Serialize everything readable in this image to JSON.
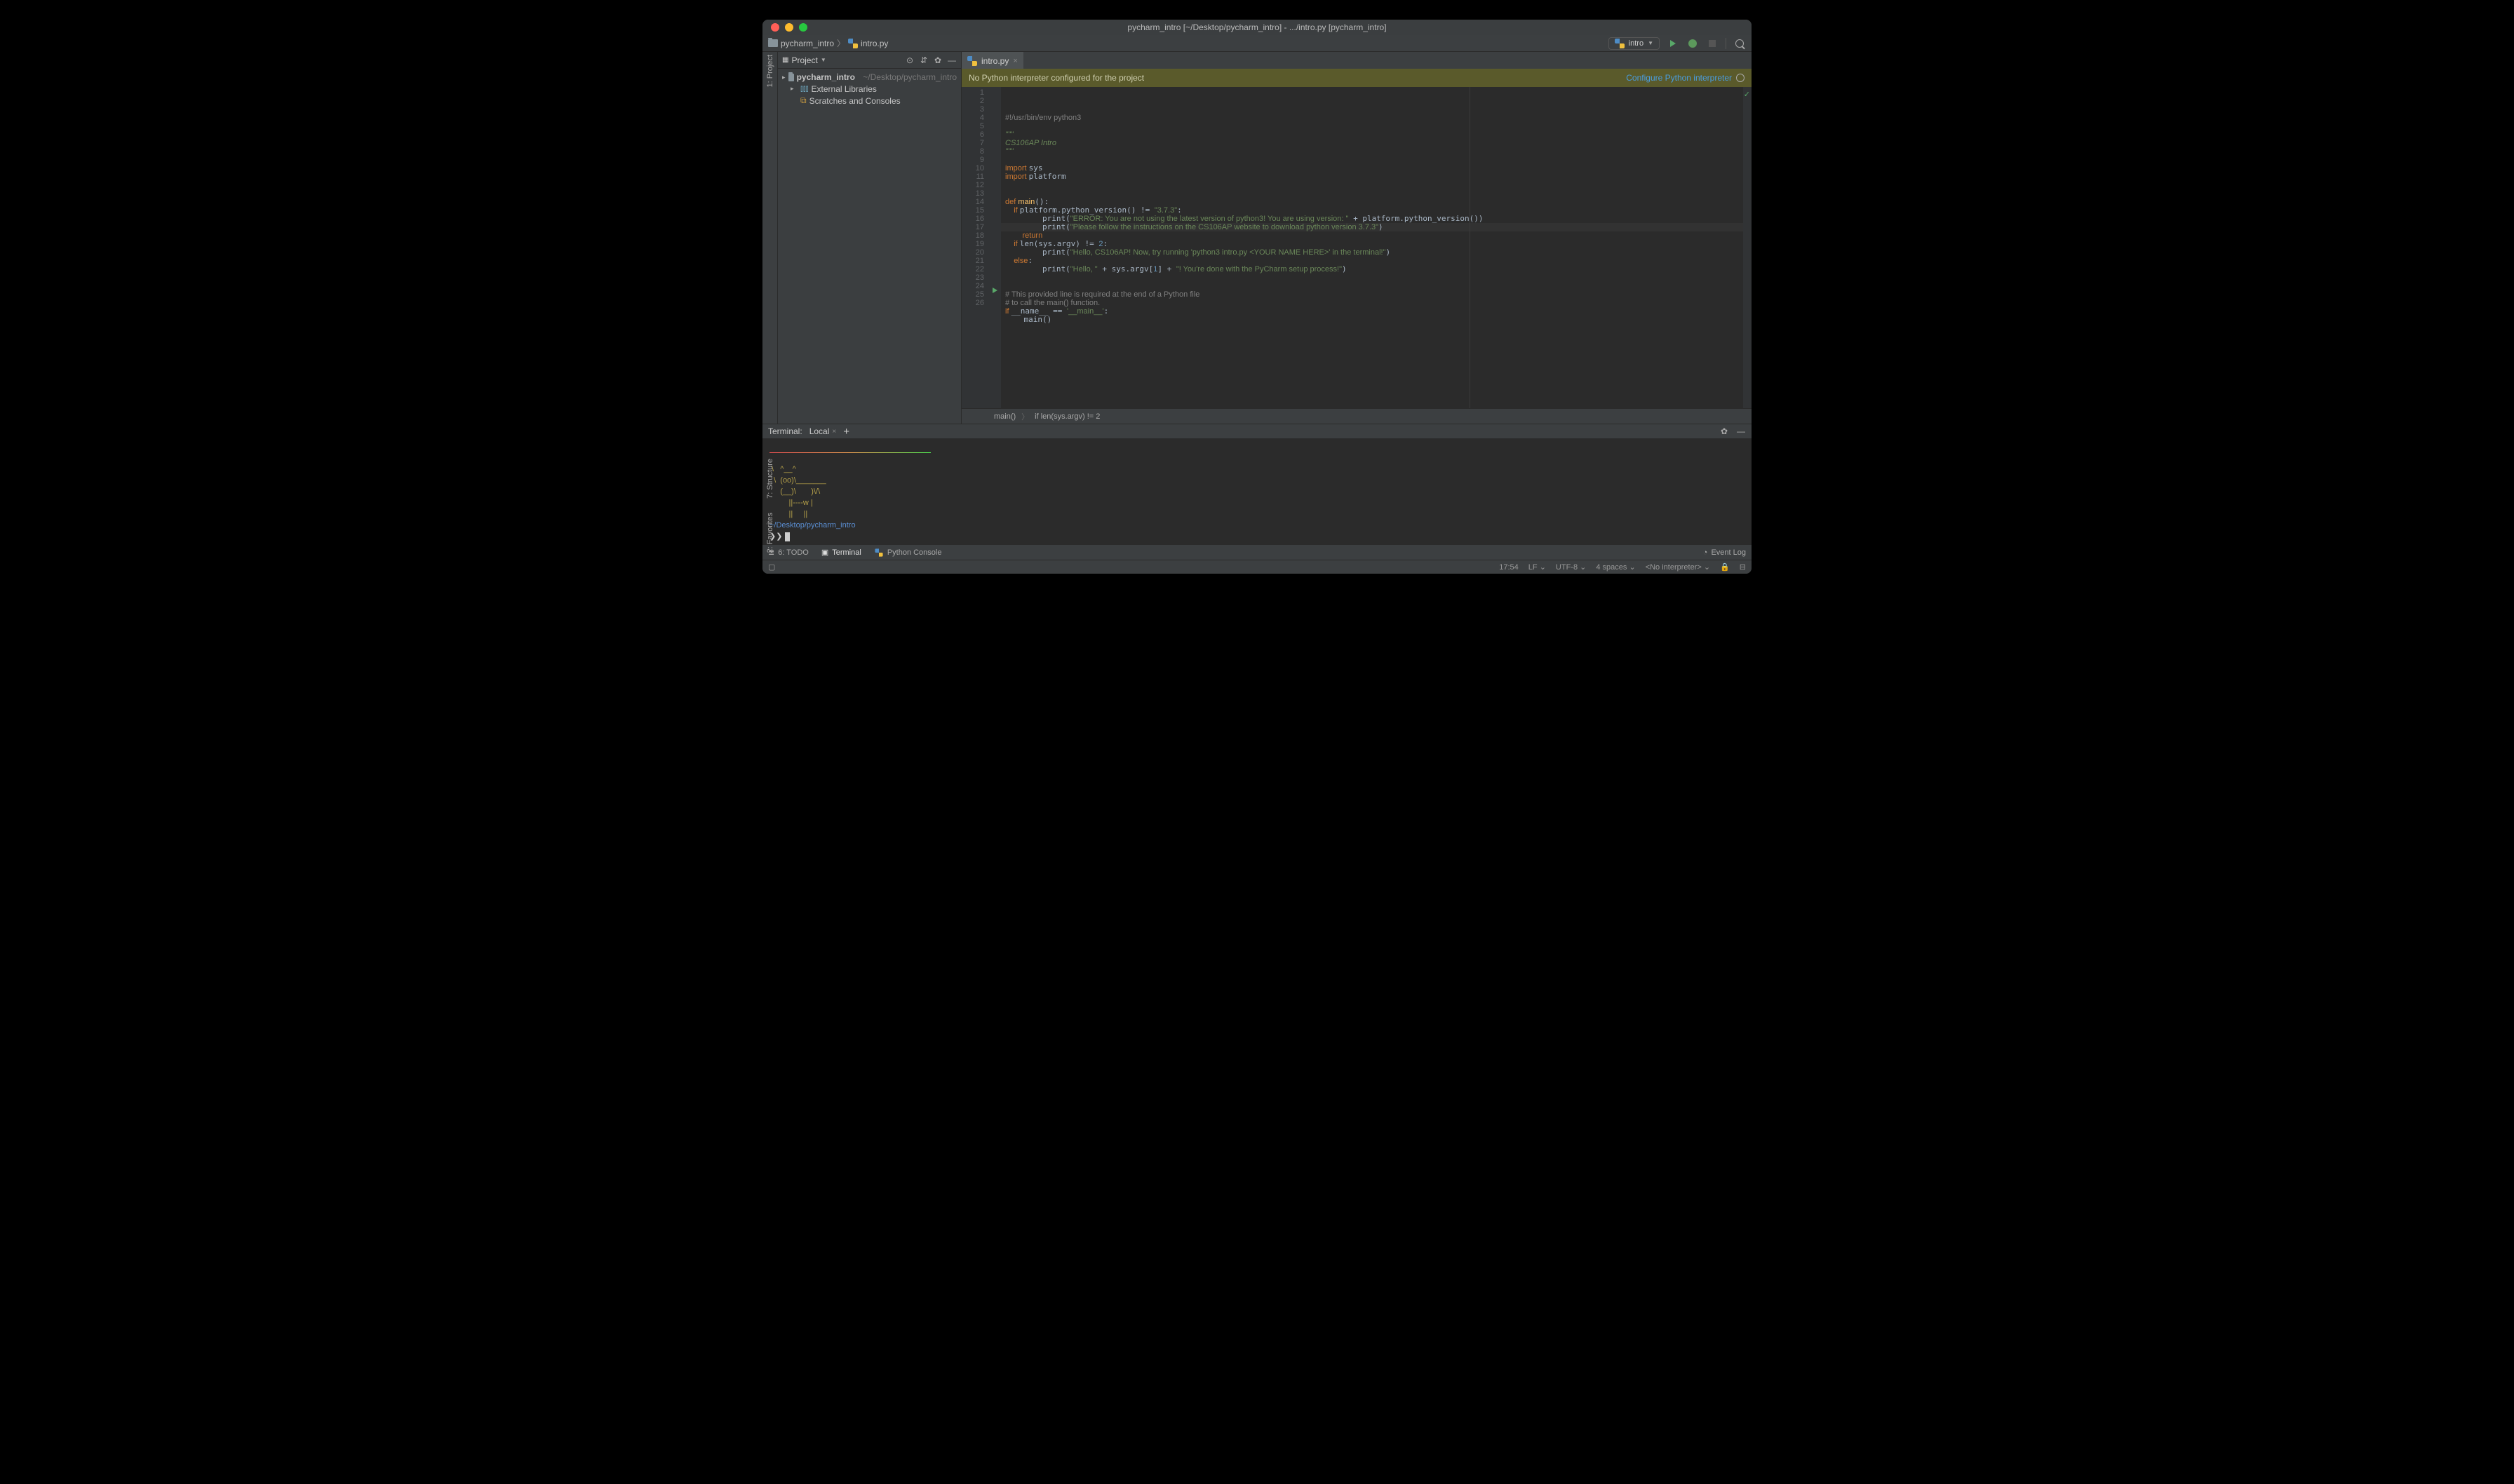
{
  "title": "pycharm_intro [~/Desktop/pycharm_intro] - .../intro.py [pycharm_intro]",
  "nav": {
    "crumb1": "pycharm_intro",
    "crumb2": "intro.py",
    "run_config": "intro"
  },
  "left_gutter": {
    "project": "1: Project",
    "structure": "7: Structure",
    "favorites": "2: Favorites"
  },
  "sidebar": {
    "header": "Project",
    "items": [
      {
        "name": "pycharm_intro",
        "path": "~/Desktop/pycharm_intro"
      },
      {
        "name": "External Libraries"
      },
      {
        "name": "Scratches and Consoles"
      }
    ]
  },
  "tab": {
    "name": "intro.py"
  },
  "banner": {
    "msg": "No Python interpreter configured for the project",
    "link": "Configure Python interpreter"
  },
  "code_lines": 26,
  "code": {
    "l1": "#!/usr/bin/env python3",
    "l3": "\"\"\"",
    "l4": "CS106AP Intro",
    "l5": "\"\"\"",
    "l7a": "import ",
    "l7b": "sys",
    "l8a": "import ",
    "l8b": "platform",
    "l11a": "def ",
    "l11b": "main",
    "l11c": "():",
    "l12a": "    if ",
    "l12b": "platform.python_version() != ",
    "l12c": "\"3.7.3\"",
    "l12d": ":",
    "l13a": "        print(",
    "l13b": "\"ERROR: You are not using the latest version of python3! You are using version: \"",
    "l13c": " + platform.python_version())",
    "l14a": "        print(",
    "l14b": "\"Please follow the instructions on the CS106AP website to download python version 3.7.3\"",
    "l14c": ")",
    "l15": "        return",
    "l16a": "    if ",
    "l16b": "len(sys.argv) != ",
    "l16c": "2",
    "l16d": ":",
    "l17a": "        print(",
    "l17b": "\"Hello, CS106AP! Now, try running 'python3 intro.py <YOUR NAME HERE>' in the terminal!\"",
    "l17c": ")",
    "l18a": "    else",
    "l18b": ":",
    "l19a": "        print(",
    "l19b": "\"Hello, \"",
    "l19c": " + sys.argv[",
    "l19d": "1",
    "l19e": "] + ",
    "l19f": "\"! You're done with the PyCharm setup process!\"",
    "l19g": ")",
    "l22": "# This provided line is required at the end of a Python file",
    "l23": "# to call the main() function.",
    "l24a": "if ",
    "l24b": "__name__ == ",
    "l24c": "'__main__'",
    "l24d": ":",
    "l25": "    main()"
  },
  "breadcrumb": {
    "fn": "main()",
    "sep": "〉",
    "cond": "if len(sys.argv) != 2"
  },
  "terminal": {
    "title": "Terminal:",
    "tab": "Local",
    "cow": " \\   ^__^\n  \\  (oo)\\_______\n     (__)\\       )\\/\\\n         ||----w |\n         ||     ||",
    "path": "~/Desktop/pycharm_intro",
    "prompt": "❯❯ "
  },
  "bottom": {
    "todo": "6: TODO",
    "terminal": "Terminal",
    "console": "Python Console",
    "eventlog": "Event Log"
  },
  "status": {
    "pos": "17:54",
    "sep": "LF",
    "enc": "UTF-8",
    "indent": "4 spaces",
    "interp": "<No interpreter>"
  }
}
